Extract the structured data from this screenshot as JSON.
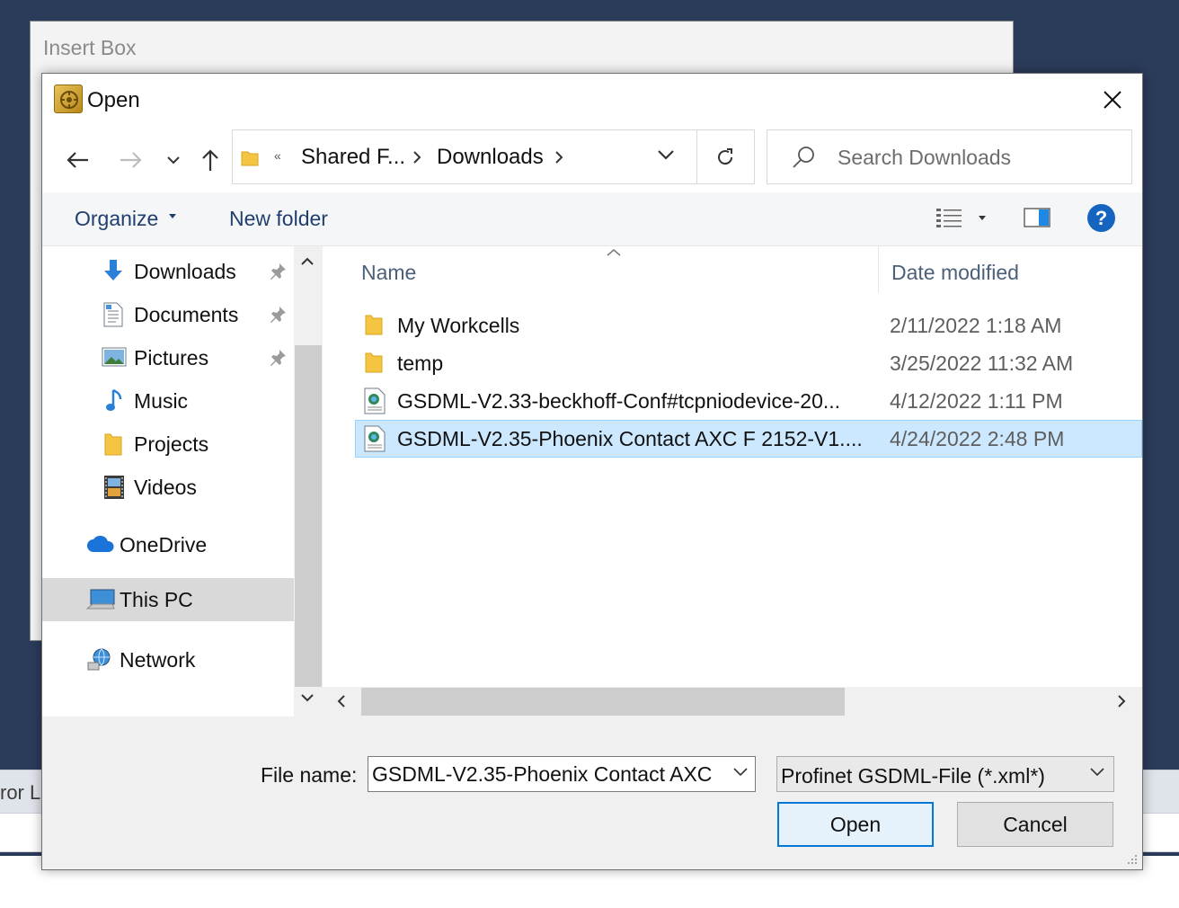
{
  "background": {
    "insert_box_title": "Insert Box",
    "error_list_label": "ror L"
  },
  "dialog": {
    "title": "Open"
  },
  "address_bar": {
    "overflow_glyph": "«",
    "crumbs": [
      "Shared F...",
      "Downloads"
    ]
  },
  "search": {
    "placeholder": "Search Downloads"
  },
  "toolbar": {
    "organize_label": "Organize",
    "new_folder_label": "New folder",
    "help_label": "?"
  },
  "nav_pane": {
    "quick_access": [
      {
        "label": "Downloads",
        "icon": "download-arrow-icon",
        "pinned": true
      },
      {
        "label": "Documents",
        "icon": "document-icon",
        "pinned": true
      },
      {
        "label": "Pictures",
        "icon": "pictures-icon",
        "pinned": true
      },
      {
        "label": "Music",
        "icon": "music-note-icon",
        "pinned": false
      },
      {
        "label": "Projects",
        "icon": "folder-icon",
        "pinned": false
      },
      {
        "label": "Videos",
        "icon": "film-icon",
        "pinned": false
      }
    ],
    "onedrive": "OneDrive",
    "this_pc": "This PC",
    "network": "Network"
  },
  "file_list": {
    "columns": {
      "name": "Name",
      "date_modified": "Date modified"
    },
    "rows": [
      {
        "name": "My Workcells",
        "date": "2/11/2022 1:18 AM",
        "type": "folder",
        "selected": false
      },
      {
        "name": "temp",
        "date": "3/25/2022 11:32 AM",
        "type": "folder",
        "selected": false
      },
      {
        "name": "GSDML-V2.33-beckhoff-Conf#tcpniodevice-20...",
        "date": "4/12/2022 1:11 PM",
        "type": "xml",
        "selected": false
      },
      {
        "name": "GSDML-V2.35-Phoenix Contact AXC F 2152-V1....",
        "date": "4/24/2022 2:48 PM",
        "type": "xml",
        "selected": true
      }
    ]
  },
  "bottom": {
    "file_name_label": "File name:",
    "file_name_value": "GSDML-V2.35-Phoenix Contact AXC",
    "file_type_value": "Profinet GSDML-File (*.xml*)",
    "open_label": "Open",
    "cancel_label": "Cancel"
  },
  "colors": {
    "accent": "#0078d7",
    "selection": "#cce8ff",
    "link_text": "#1f3f6e",
    "help": "#1565c0"
  }
}
